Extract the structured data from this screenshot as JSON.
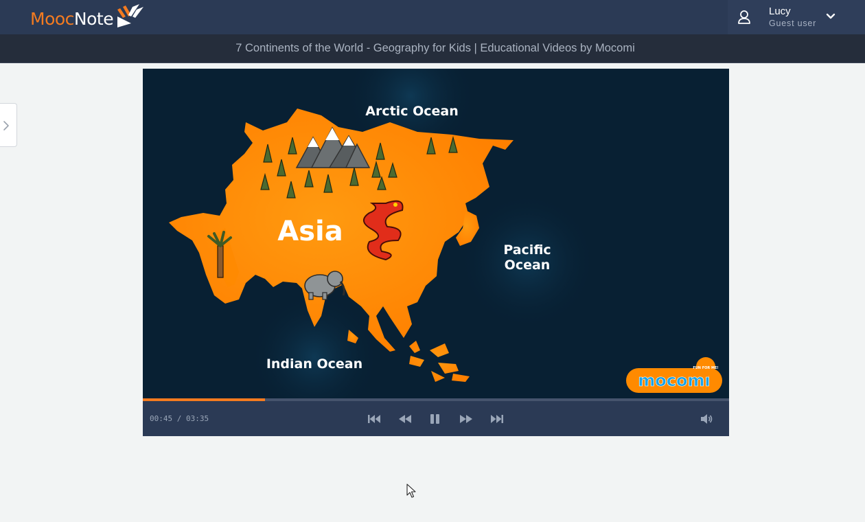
{
  "app": {
    "logo_part1": "Mooc",
    "logo_part2": "Note",
    "brand_color": "#f47b20"
  },
  "user": {
    "name": "Lucy",
    "role": "Guest user"
  },
  "video": {
    "title": "7 Continents of the World - Geography for Kids | Educational Videos by Mocomi",
    "current_time": "00:45",
    "duration": "03:35",
    "time_display": "00:45 / 03:35",
    "progress": 0.209,
    "frame": {
      "continent": "Asia",
      "ocean_north": "Arctic Ocean",
      "ocean_east_line1": "Pacific",
      "ocean_east_line2": "Ocean",
      "ocean_south": "Indian Ocean",
      "watermark": "mocomi",
      "watermark_tag": "FUN FOR ME!"
    }
  },
  "controls": {
    "icons": [
      "skip-back-icon",
      "rewind-icon",
      "pause-icon",
      "fast-forward-icon",
      "skip-forward-icon",
      "volume-icon"
    ]
  }
}
